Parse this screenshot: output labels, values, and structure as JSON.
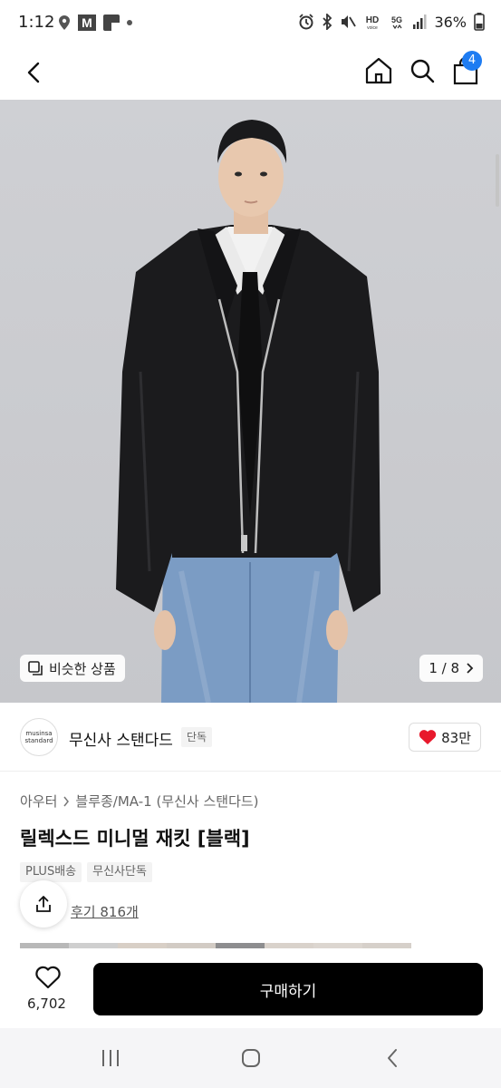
{
  "status_bar": {
    "time": "1:12",
    "battery": "36%",
    "icons": [
      "location-icon",
      "gmail-icon",
      "app-icon",
      "dot-icon",
      "alarm-icon",
      "bluetooth-icon",
      "mute-icon",
      "hd-voice-icon",
      "5g-icon",
      "signal-icon",
      "battery-icon"
    ]
  },
  "header": {
    "cart_count": "4",
    "icons": [
      "back-icon",
      "home-icon",
      "search-icon",
      "cart-icon"
    ]
  },
  "hero": {
    "similar_label": "비슷한 상품",
    "pager": "1 / 8"
  },
  "brand": {
    "logo_line1": "musinsa",
    "logo_line2": "standard",
    "name": "무신사 스탠다드",
    "exclusive": "단독",
    "likes": "83만"
  },
  "product": {
    "category1": "아우터",
    "category2": "블루종/MA-1 (무신사 스탠다드)",
    "title": "릴렉스드 미니멀 재킷 [블랙]",
    "tags": [
      "PLUS배송",
      "무신사단독"
    ],
    "reviews": "후기 816개"
  },
  "bottom": {
    "wish_count": "6,702",
    "buy_label": "구매하기"
  },
  "colors": {
    "accent": "#1e7cf2",
    "heart": "#e8192c",
    "buy_button": "#000000"
  }
}
